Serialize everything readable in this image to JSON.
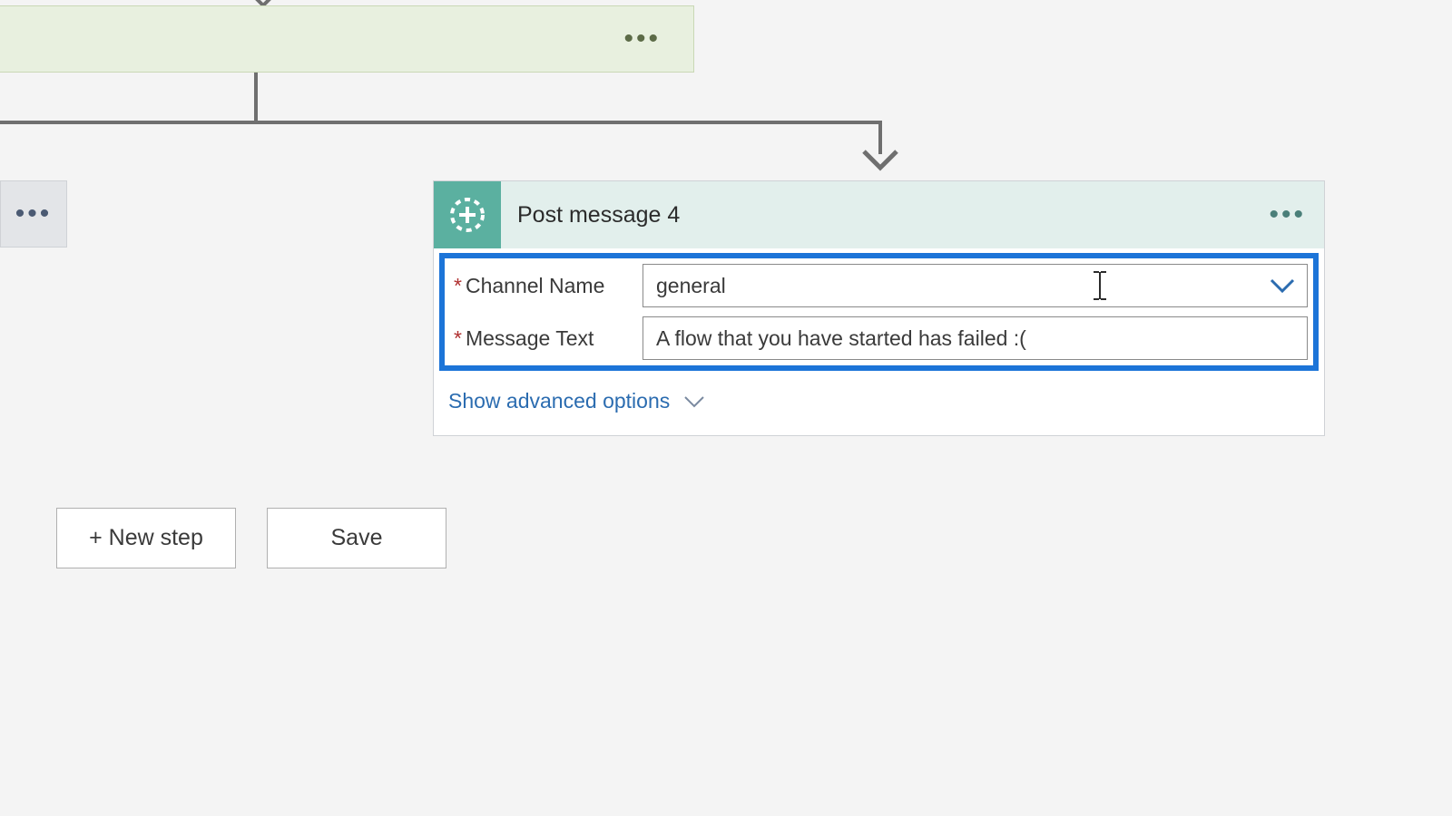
{
  "action": {
    "title": "Post message 4",
    "channel_label": "Channel Name",
    "channel_value": "general",
    "message_label": "Message Text",
    "message_value": "A flow that you have started has failed :(",
    "advanced_label": "Show advanced options"
  },
  "buttons": {
    "new_step": "+ New step",
    "save": "Save"
  }
}
